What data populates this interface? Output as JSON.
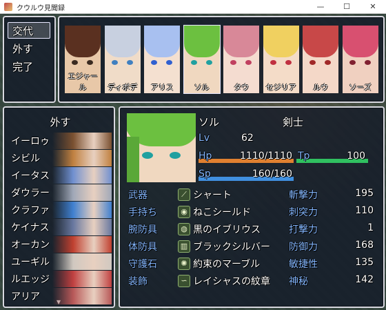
{
  "window": {
    "title": "クウルウ見聞録",
    "minimize": "—",
    "maximize": "☐",
    "close": "✕"
  },
  "commands": [
    {
      "label": "交代",
      "selected": true
    },
    {
      "label": "外す"
    },
    {
      "label": "完了"
    }
  ],
  "party": [
    {
      "name": "エジャール",
      "hair": "#5a3020",
      "eyes": "#3a2a20",
      "skin": "#e8c8a8"
    },
    {
      "name": "ディボデ",
      "hair": "#c8d0e0",
      "eyes": "#4080c0",
      "skin": "#f0dcc8"
    },
    {
      "name": "アリス",
      "hair": "#a8c0f0",
      "eyes": "#3060d0",
      "skin": "#f4e0d0"
    },
    {
      "name": "ソル",
      "hair": "#6cc040",
      "eyes": "#20a0a0",
      "skin": "#f0d8c0",
      "selected": true
    },
    {
      "name": "タウ",
      "hair": "#d88898",
      "eyes": "#c04060",
      "skin": "#f4dcd0"
    },
    {
      "name": "セジリア",
      "hair": "#f0d060",
      "eyes": "#c03040",
      "skin": "#f4dcc8"
    },
    {
      "name": "ルウ",
      "hair": "#c84848",
      "eyes": "#a02828",
      "skin": "#f4d8c8"
    },
    {
      "name": "ソーズ",
      "hair": "#d85070",
      "eyes": "#802030",
      "skin": "#f0d0c0"
    }
  ],
  "list": {
    "header": "外す",
    "items": [
      {
        "label": "イーロゥ",
        "color": "#7a5030"
      },
      {
        "label": "シビル",
        "color": "#c08040"
      },
      {
        "label": "イータス",
        "color": "#7090d0"
      },
      {
        "label": "ダウラー",
        "color": "#a0a8b8"
      },
      {
        "label": "クラファ",
        "color": "#4080d0"
      },
      {
        "label": "ケイナス",
        "color": "#6878a0"
      },
      {
        "label": "オーカン",
        "color": "#c04030"
      },
      {
        "label": "ユーギル",
        "color": "#d0c8c0"
      },
      {
        "label": "ルエッジ",
        "color": "#c04040"
      },
      {
        "label": "アリア",
        "color": "#b85858"
      }
    ],
    "more": "▼"
  },
  "status": {
    "name": "ソル",
    "class": "剣士",
    "lv_label": "Lv",
    "lv": "62",
    "hp_label": "Hp",
    "hp": "1110/1110",
    "hp_ratio": 1.0,
    "tp_label": "Tp",
    "tp": "100",
    "tp_ratio": 1.0,
    "sp_label": "Sp",
    "sp": "160/160",
    "sp_ratio": 1.0,
    "colors": {
      "hp": "#e08030",
      "tp": "#30c060",
      "sp": "#4090e0"
    }
  },
  "equipment": [
    {
      "slot": "武器",
      "icon": "sword-icon",
      "glyph": "⟋",
      "item": "シャート",
      "stat": "斬撃力",
      "value": "195"
    },
    {
      "slot": "手持ち",
      "icon": "shield-icon",
      "glyph": "◉",
      "item": "ねこシールド",
      "stat": "刺突力",
      "value": "110"
    },
    {
      "slot": "腕防具",
      "icon": "armlet-icon",
      "glyph": "◍",
      "item": "黒のイブリウス",
      "stat": "打撃力",
      "value": "1"
    },
    {
      "slot": "体防具",
      "icon": "armor-icon",
      "glyph": "▥",
      "item": "ブラックシルバー",
      "stat": "防御力",
      "value": "168"
    },
    {
      "slot": "守護石",
      "icon": "stone-icon",
      "glyph": "✺",
      "item": "約束のマーブル",
      "stat": "敏捷性",
      "value": "135"
    },
    {
      "slot": "装飾",
      "icon": "accessory-icon",
      "glyph": "∽",
      "item": "レイシャスの紋章",
      "stat": "神秘",
      "value": "142"
    }
  ]
}
